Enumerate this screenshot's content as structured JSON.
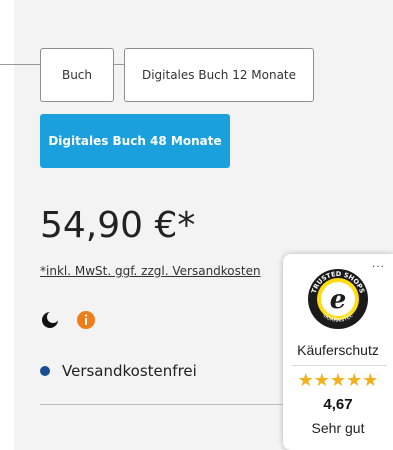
{
  "options": {
    "buch": "Buch",
    "digital_12": "Digitales Buch 12 Monate",
    "digital_48": "Digitales Buch 48 Monate",
    "selected": "Digitales Buch 48 Monate"
  },
  "price": "54,90 €*",
  "tax_note": "*inkl. MwSt. ggf. zzgl. Versandkosten",
  "icons": [
    "moon-icon",
    "info-icon"
  ],
  "shipping": "Versandkostenfrei",
  "trusted_shops": {
    "seal_text_top": "TRUSTED SHOPS",
    "seal_text_bottom": "GUARANTEE",
    "seal_letter": "e",
    "more": "...",
    "label": "Käuferschutz",
    "stars": "★★★★★",
    "score": "4,67",
    "rating_word": "Sehr gut"
  },
  "colors": {
    "accent": "#1aa0dd",
    "star": "#f2b01e",
    "info_badge": "#f07d1a",
    "dot": "#1a4d8f"
  }
}
